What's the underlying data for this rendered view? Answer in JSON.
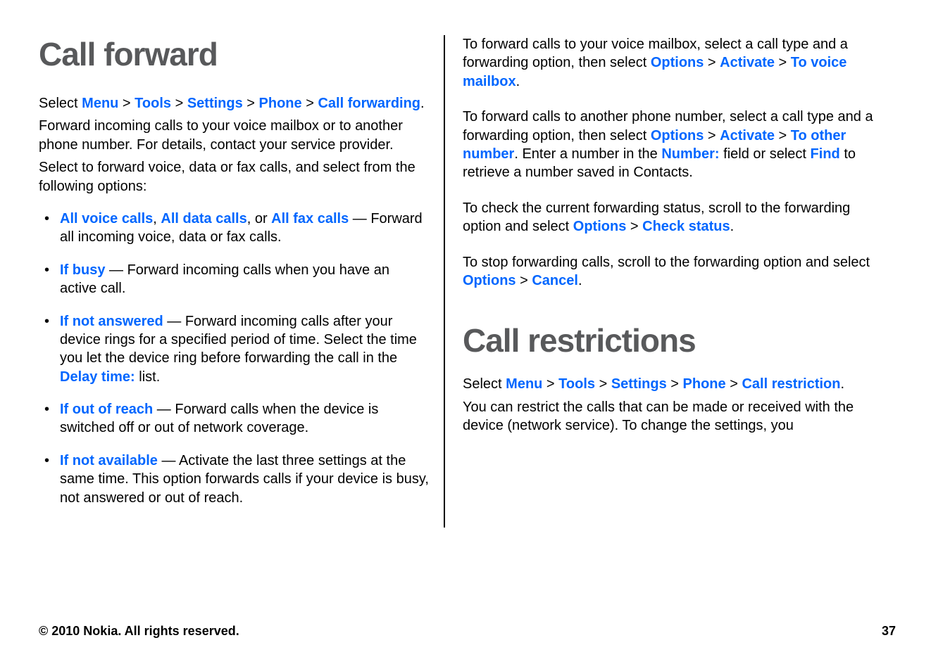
{
  "left": {
    "heading1": "Call forward",
    "para_select_prefix": "Select ",
    "nav": {
      "menu": "Menu",
      "tools": "Tools",
      "settings": "Settings",
      "phone": "Phone",
      "call_forwarding": "Call forwarding"
    },
    "sep": " > ",
    "period": ".",
    "para2": "Forward incoming calls to your voice mailbox or to another phone number. For details, contact your service provider.",
    "para3": "Select to forward voice, data or fax calls, and select from the following options:",
    "items": [
      {
        "k1": "All voice calls",
        "mid1": ", ",
        "k2": "All data calls",
        "mid2": ", or ",
        "k3": "All fax calls",
        "tail": " — Forward all incoming voice, data or fax calls."
      },
      {
        "k1": "If busy",
        "tail": "  — Forward incoming calls when you have an active call."
      },
      {
        "k1": "If not answered",
        "mid1": "  — Forward incoming calls after your device rings for a specified period of time. Select the time you let the device ring before forwarding the call in the ",
        "k2": "Delay time:",
        "tail": " list."
      },
      {
        "k1": "If out of reach",
        "tail": "  — Forward calls when the device is switched off or out of network coverage."
      },
      {
        "k1": "If not available",
        "tail": "  — Activate the last three settings at the same time. This option forwards calls if your device is busy, not answered or out of reach."
      }
    ]
  },
  "right": {
    "p1_a": "To forward calls to your voice mailbox, select a call type and a forwarding option, then select ",
    "p1_k1": "Options",
    "p1_k2": "Activate",
    "p1_k3": "To voice mailbox",
    "p1_end": ".",
    "p2_a": "To forward calls to another phone number, select a call type and a forwarding option, then select ",
    "p2_k1": "Options",
    "p2_k2": "Activate",
    "p2_k3": "To other number",
    "p2_mid": ". Enter a number in the ",
    "p2_k4": "Number:",
    "p2_mid2": " field or select ",
    "p2_k5": "Find",
    "p2_end": " to retrieve a number saved in Contacts.",
    "p3_a": "To check the current forwarding status, scroll to the forwarding option and select ",
    "p3_k1": "Options",
    "p3_k2": "Check status",
    "p3_end": ".",
    "p4_a": "To stop forwarding calls, scroll to the forwarding option and select ",
    "p4_k1": "Options",
    "p4_k2": "Cancel",
    "p4_end": ".",
    "heading2": "Call restrictions",
    "nav": {
      "menu": "Menu",
      "tools": "Tools",
      "settings": "Settings",
      "phone": "Phone",
      "call_restriction": "Call restriction"
    },
    "p5": "You can restrict the calls that can be made or received with the device (network service). To change the settings, you"
  },
  "sep": " > ",
  "footer": {
    "copyright": "© 2010 Nokia. All rights reserved.",
    "page": "37"
  }
}
